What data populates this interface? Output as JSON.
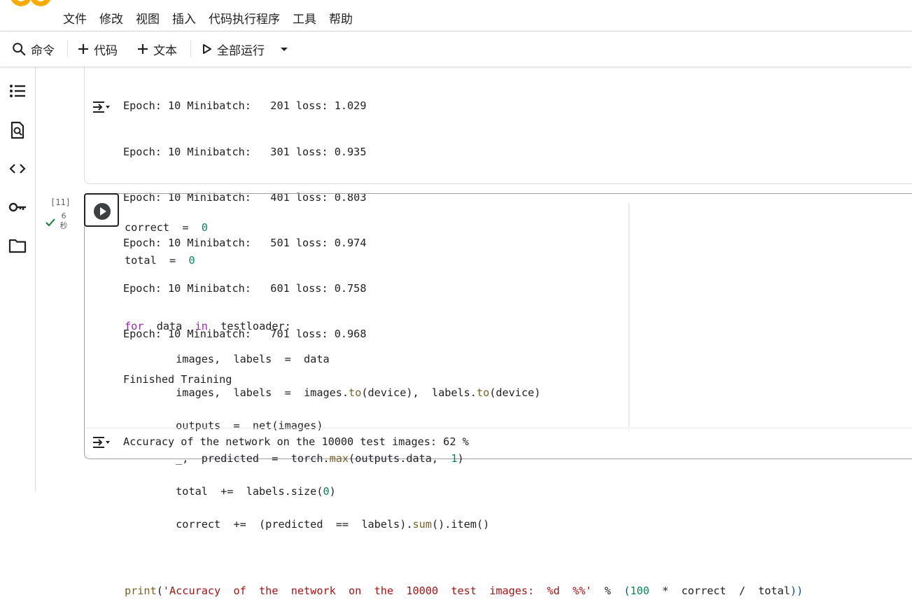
{
  "menu": [
    "文件",
    "修改",
    "视图",
    "插入",
    "代码执行程序",
    "工具",
    "帮助"
  ],
  "toolbar": {
    "command": "命令",
    "add_code": "代码",
    "add_text": "文本",
    "run_all": "全部运行"
  },
  "prev_output": {
    "lines": [
      "Epoch: 10 Minibatch:   201 loss: 1.029",
      "Epoch: 10 Minibatch:   301 loss: 0.935",
      "Epoch: 10 Minibatch:   401 loss: 0.803",
      "Epoch: 10 Minibatch:   501 loss: 0.974",
      "Epoch: 10 Minibatch:   601 loss: 0.758",
      "Epoch: 10 Minibatch:   701 loss: 0.968",
      "Finished Training"
    ]
  },
  "cell": {
    "exec_count": "[11]",
    "exec_time_value": "6",
    "exec_time_unit": "秒",
    "code": {
      "l1_a": "correct",
      "l1_op": "=",
      "l1_n": "0",
      "l2_a": "total",
      "l2_op": "=",
      "l2_n": "0",
      "l4_for": "for",
      "l4_var": "data",
      "l4_in": "in",
      "l4_iter": "testloader:",
      "l5": "images,  labels  =  data",
      "l6_a": "images,  labels  =  images.",
      "l6_to1": "to",
      "l6_p1": "(device),  labels.",
      "l6_to2": "to",
      "l6_p2": "(device)",
      "l7_a": "outputs  =  net",
      "l7_p": "(images)",
      "l8_a": "_,  predicted  =  torch.",
      "l8_fn": "max",
      "l8_p": "(outputs.data,  ",
      "l8_n": "1",
      "l8_e": ")",
      "l9_a": "total  +=  labels.size",
      "l9_p": "(",
      "l9_n": "0",
      "l9_e": ")",
      "l10_a": "correct  +=  ",
      "l10_p": "(predicted  ==  labels)",
      "l10_b": ".",
      "l10_fn": "sum",
      "l10_c": "().item()",
      "l12_fn": "print",
      "l12_p": "(",
      "l12_str": "'Accuracy  of  the  network  on  the  10000  test  images:  %d  %%'",
      "l12_op": "  %  ",
      "l12_p2": "(",
      "l12_n": "100",
      "l12_rest": "  *  correct  /  total",
      "l12_e": "))"
    },
    "output": "Accuracy of the network on the 10000 test images: 62 %"
  },
  "colors": {
    "accent_orange": "#f9ab00",
    "keyword_purple": "#9c27b0",
    "number_green": "#098658",
    "string_red": "#a31515",
    "check_green": "#188038"
  }
}
